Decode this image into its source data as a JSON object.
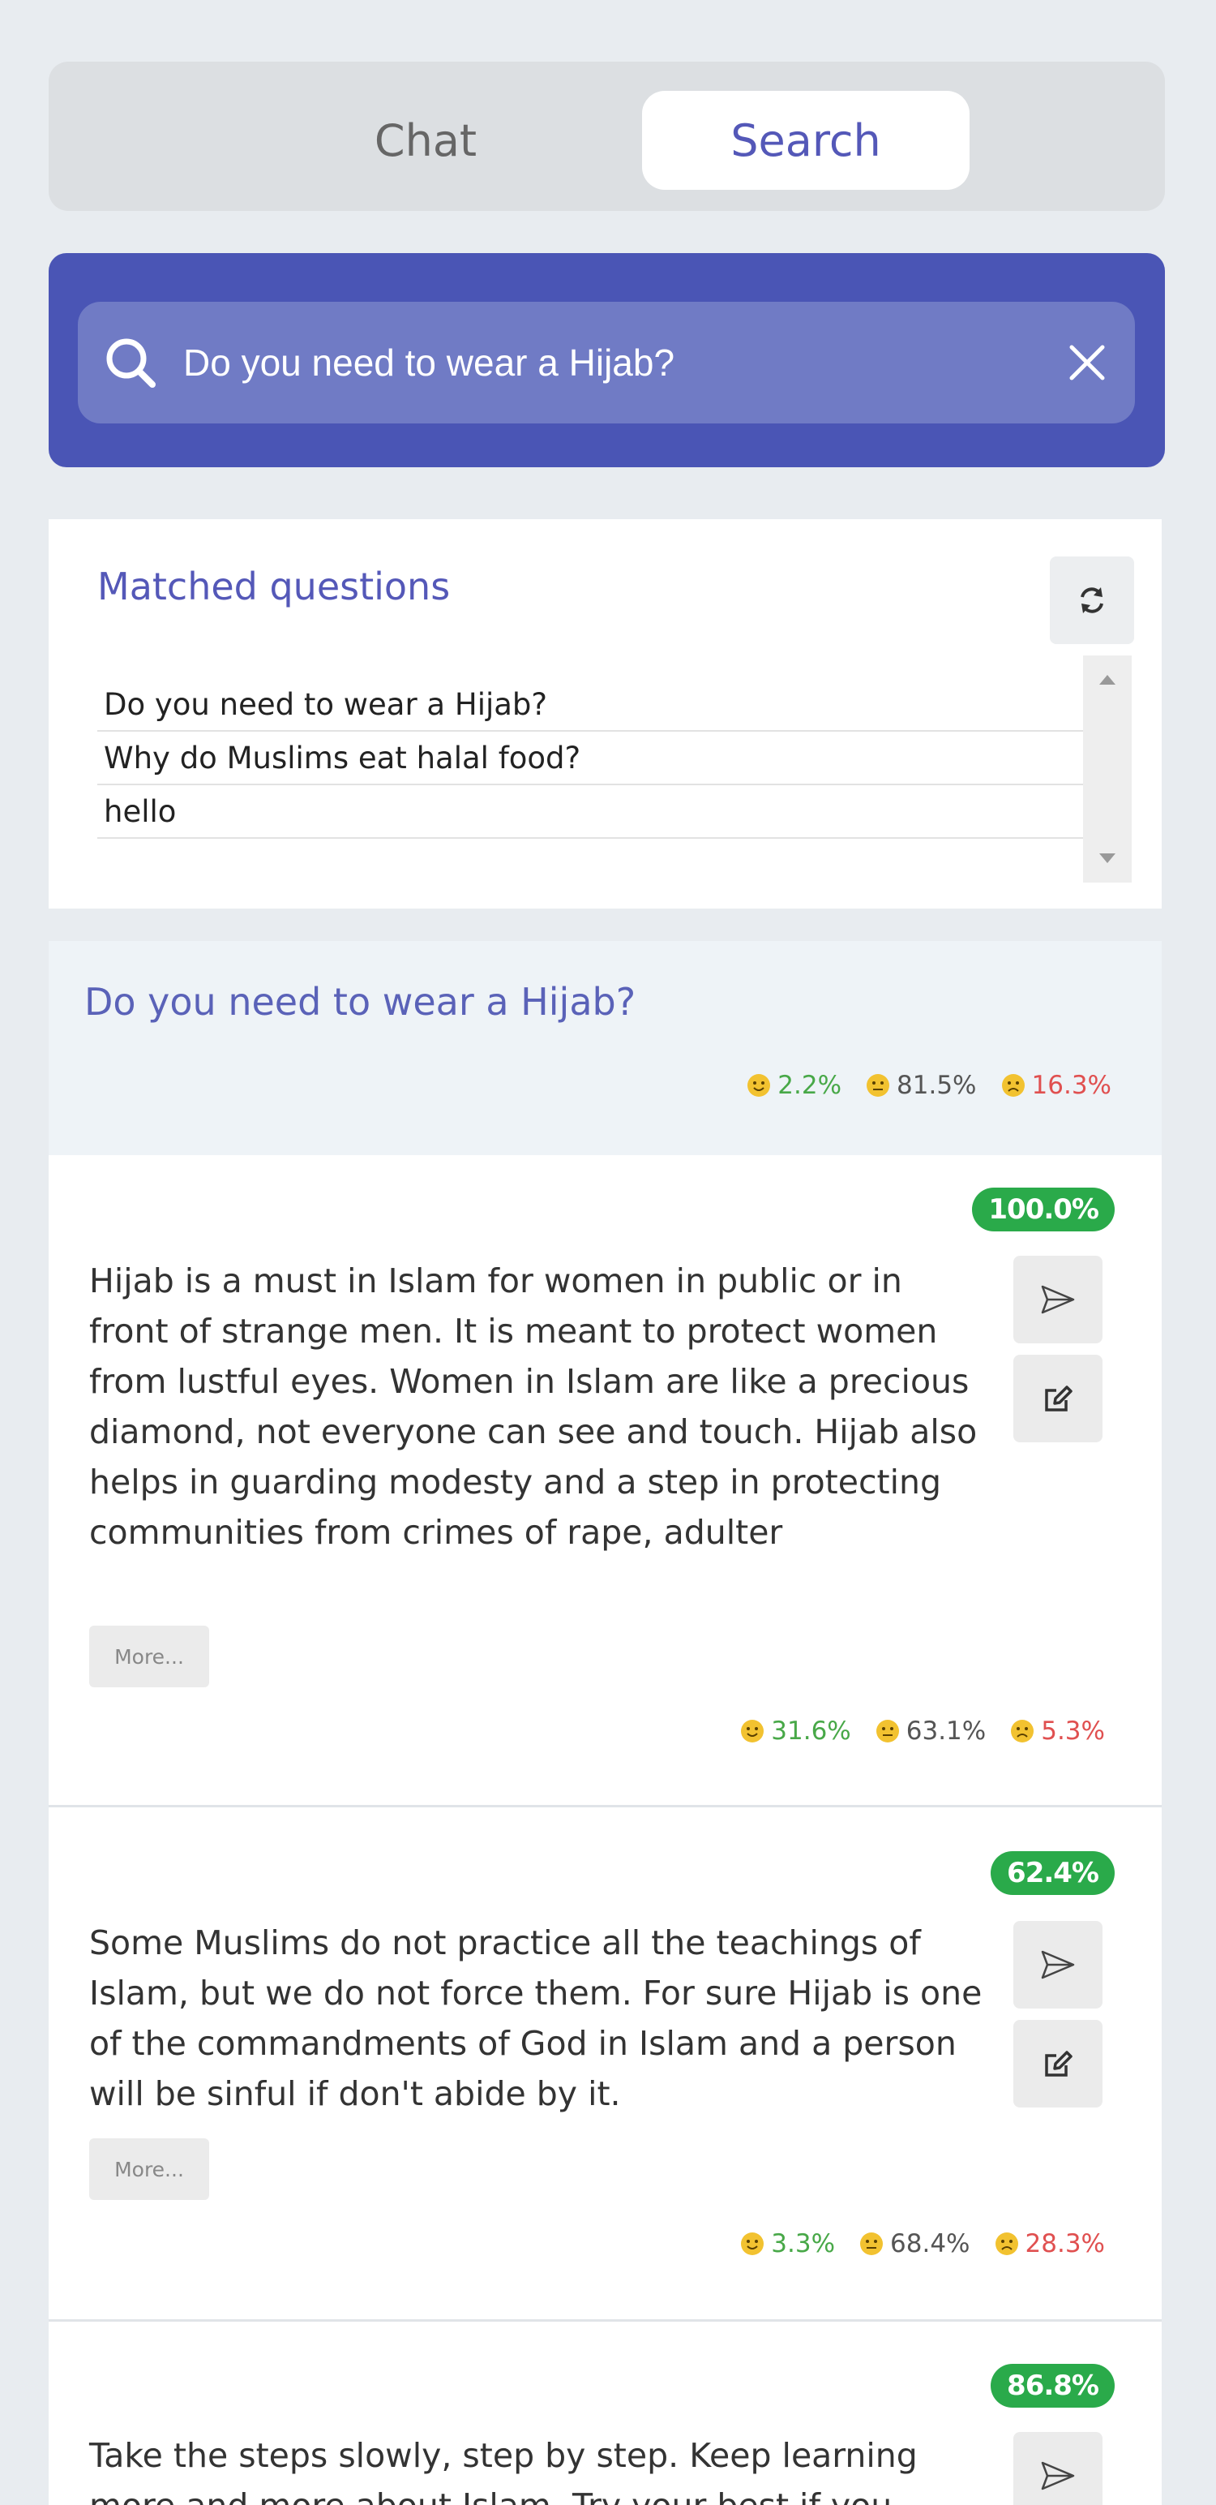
{
  "tabs": {
    "chat_label": "Chat",
    "search_label": "Search",
    "active": "Search"
  },
  "search": {
    "query": "Do you need to wear a Hijab?"
  },
  "matched": {
    "title": "Matched questions",
    "questions": [
      "Do you need to wear a Hijab?",
      "Why do Muslims eat halal food?",
      "hello"
    ]
  },
  "result": {
    "question": "Do you need to wear a Hijab?",
    "sentiment": {
      "positive": "2.2%",
      "neutral": "81.5%",
      "negative": "16.3%"
    }
  },
  "answers": [
    {
      "score": "100.0%",
      "text": "Hijab is a must in Islam for women in public or in front of strange men. It is meant to protect women from lustful eyes. Women in Islam are like a precious diamond, not everyone can see and touch. Hijab also helps in guarding modesty and a step in protecting communities from crimes of rape, adulter",
      "more_label": "More...",
      "sentiment": {
        "positive": "31.6%",
        "neutral": "63.1%",
        "negative": "5.3%"
      }
    },
    {
      "score": "62.4%",
      "text": "Some Muslims do not practice all the teachings of Islam, but we do not force them. For sure Hijab is one of the commandments of God in Islam and a person will be sinful if don't abide by it.",
      "more_label": "More...",
      "sentiment": {
        "positive": "3.3%",
        "neutral": "68.4%",
        "negative": "28.3%"
      }
    },
    {
      "score": "86.8%",
      "text": "Take the steps slowly, step by step. Keep learning more and more about Islam. Try your best if you"
    }
  ],
  "colors": {
    "accent": "#4a55b5",
    "badge": "#2aaa4a",
    "positive": "#48a848",
    "negative": "#e05050"
  },
  "icons": {
    "search": "search-icon",
    "clear": "close-icon",
    "refresh": "refresh-icon",
    "send": "send-icon",
    "edit": "edit-icon",
    "sentiment": "face-icon"
  }
}
